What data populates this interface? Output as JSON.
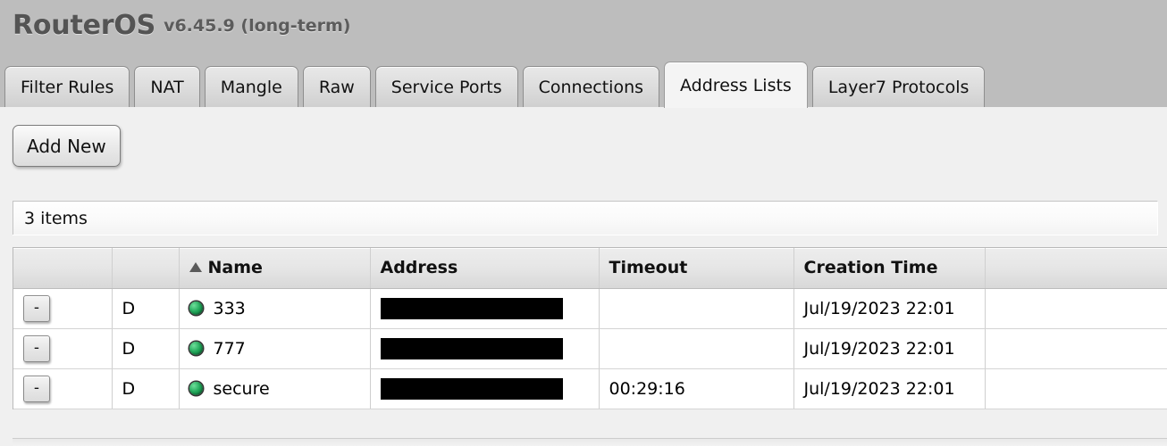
{
  "header": {
    "brand": "RouterOS",
    "version": "v6.45.9 (long-term)"
  },
  "tabs": [
    {
      "label": "Filter Rules",
      "active": false
    },
    {
      "label": "NAT",
      "active": false
    },
    {
      "label": "Mangle",
      "active": false
    },
    {
      "label": "Raw",
      "active": false
    },
    {
      "label": "Service Ports",
      "active": false
    },
    {
      "label": "Connections",
      "active": false
    },
    {
      "label": "Address Lists",
      "active": true
    },
    {
      "label": "Layer7 Protocols",
      "active": false
    }
  ],
  "toolbar": {
    "add_new_label": "Add New"
  },
  "status": {
    "item_count_text": "3 items"
  },
  "table": {
    "sort_indicator": "ascending",
    "columns": [
      {
        "key": "delete",
        "label": ""
      },
      {
        "key": "flags",
        "label": ""
      },
      {
        "key": "name",
        "label": "Name",
        "sorted": true
      },
      {
        "key": "address",
        "label": "Address"
      },
      {
        "key": "timeout",
        "label": "Timeout"
      },
      {
        "key": "creation_time",
        "label": "Creation Time"
      },
      {
        "key": "spacer",
        "label": ""
      }
    ],
    "rows": [
      {
        "delete_label": "-",
        "flags": "D",
        "status_icon": "green-dynamic-dot-icon",
        "name": "333",
        "address": "",
        "address_redacted": true,
        "timeout": "",
        "creation_time": "Jul/19/2023 22:01",
        "spacer": ""
      },
      {
        "delete_label": "-",
        "flags": "D",
        "status_icon": "green-dynamic-dot-icon",
        "name": "777",
        "address": "",
        "address_redacted": true,
        "timeout": "",
        "creation_time": "Jul/19/2023 22:01",
        "spacer": ""
      },
      {
        "delete_label": "-",
        "flags": "D",
        "status_icon": "green-dynamic-dot-icon",
        "name": "secure",
        "address": "",
        "address_redacted": true,
        "timeout": "00:29:16",
        "creation_time": "Jul/19/2023 22:01",
        "spacer": ""
      }
    ]
  },
  "colors": {
    "titlebar_bg": "#bdbdbd",
    "content_bg": "#f0f0f0",
    "active_tab_bg": "#f4f4f4",
    "status_dot_green": "#21a85a",
    "redaction_black": "#000000"
  }
}
